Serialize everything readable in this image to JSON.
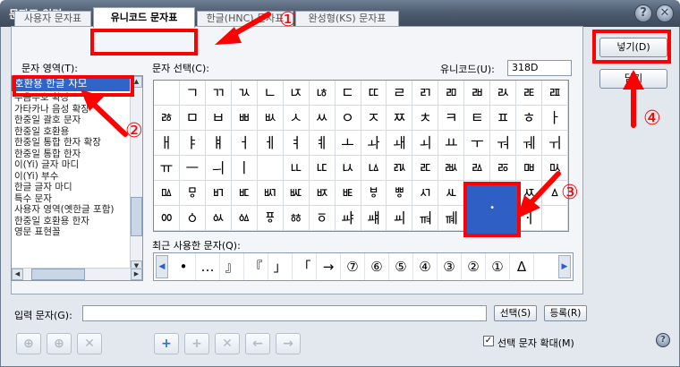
{
  "window": {
    "title": "문자표 입력",
    "help_glyph": "?",
    "close_glyph": "✕"
  },
  "tabs": [
    {
      "label": "사용자 문자표"
    },
    {
      "label": "유니코드 문자표",
      "active": true
    },
    {
      "label": "한글(HNC) 문자표"
    },
    {
      "label": "완성형(KS) 문자표"
    }
  ],
  "area": {
    "label": "문자 영역(T):",
    "items": [
      "호환용 한글 자모",
      "주음부호 확장",
      "가타카나 음성 확장",
      "한중일 괄호 문자",
      "한중일 호환용",
      "한중일 통합 한자 확장",
      "한중일 통합 한자",
      "이(Yi) 글자 마디",
      "이(Yi) 부수",
      "한글 글자 마디",
      "특수 문자",
      "사용자 영역(옛한글 포함)",
      "한중일 호환용 한자",
      "영문 표현꼴"
    ]
  },
  "char_select": {
    "label": "문자 선택(C):",
    "unicode_label": "유니코드(U):",
    "unicode_value": "318D",
    "grid": [
      [
        "",
        "ㄱ",
        "ㄲ",
        "ㄳ",
        "ㄴ",
        "ㄵ",
        "ㄶ",
        "ㄷ",
        "ㄸ",
        "ㄹ",
        "ㄺ",
        "ㄻ",
        "ㄼ",
        "ㄽ",
        "ㄾ",
        "ㄿ"
      ],
      [
        "ㅀ",
        "ㅁ",
        "ㅂ",
        "ㅃ",
        "ㅄ",
        "ㅅ",
        "ㅆ",
        "ㅇ",
        "ㅈ",
        "ㅉ",
        "ㅊ",
        "ㅋ",
        "ㅌ",
        "ㅍ",
        "ㅎ",
        "ㅏ"
      ],
      [
        "ㅐ",
        "ㅑ",
        "ㅒ",
        "ㅓ",
        "ㅔ",
        "ㅕ",
        "ㅖ",
        "ㅗ",
        "ㅘ",
        "ㅙ",
        "ㅚ",
        "ㅛ",
        "ㅜ",
        "ㅝ",
        "ㅞ",
        "ㅟ"
      ],
      [
        "ㅠ",
        "ㅡ",
        "ㅢ",
        "ㅣ",
        "ㅤ",
        "ㅥ",
        "ㅦ",
        "ㅧ",
        "ㅨ",
        "ㅩ",
        "ㅪ",
        "ㅫ",
        "ㅬ",
        "ㅭ",
        "ㅮ",
        "ㅯ"
      ],
      [
        "ㅰ",
        "ㅱ",
        "ㅲ",
        "ㅳ",
        "ㅴ",
        "ㅵ",
        "ㅶ",
        "ㅷ",
        "ㅸ",
        "ㅹ",
        "ㅺ",
        "ㅻ",
        "ㅼ",
        "ㅽ",
        "ㅾ",
        "ㅿ"
      ],
      [
        "ㆀ",
        "ㆁ",
        "ㆂ",
        "ㆃ",
        "ㆄ",
        "ㆅ",
        "ㆆ",
        "ㆇ",
        "ㆈ",
        "ㆉ",
        "ㆊ",
        "ㆋ",
        "ㆌ",
        "ㆍ",
        "ㆎ",
        ""
      ]
    ],
    "selected_char": "ㆍ"
  },
  "recent": {
    "label": "최근 사용한 문자(Q):",
    "chars": [
      "•",
      "…",
      "』",
      "『",
      "」",
      "「",
      "→",
      "⑦",
      "⑥",
      "⑤",
      "④",
      "③",
      "②",
      "①",
      "Δ"
    ],
    "left_arrow": "◀",
    "right_arrow": "▶"
  },
  "buttons": {
    "insert": "넣기(D)",
    "close": "닫기",
    "select": "선택(S)",
    "register": "등록(R)"
  },
  "input_row": {
    "label": "입력 문자(G):",
    "value": ""
  },
  "toolbar": {
    "add": "+",
    "delete": "✕",
    "left": "←",
    "right": "→",
    "copy": "⊕"
  },
  "options": {
    "enlarge_label": "선택 문자 확대(M)",
    "enlarge_checked": true
  },
  "annotations": {
    "markers": [
      "①",
      "②",
      "③",
      "④"
    ]
  },
  "colors": {
    "highlight": "#ff0000",
    "selection": "#3264c8"
  }
}
